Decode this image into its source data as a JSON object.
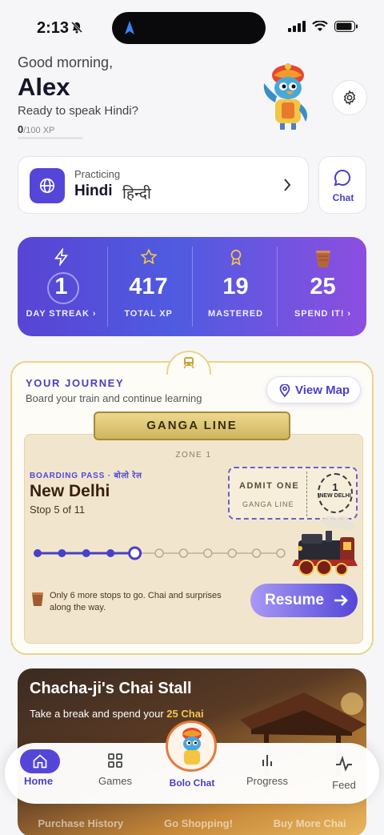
{
  "status_bar": {
    "time": "2:13"
  },
  "header": {
    "greeting": "Good morning,",
    "name": "Alex",
    "prompt": "Ready to speak Hindi?",
    "xp_current": "0",
    "xp_total": "/100 XP",
    "xp_progress": 0
  },
  "language_card": {
    "label": "Practicing",
    "language": "Hindi",
    "native": "हिन्दी"
  },
  "chat_card": {
    "label": "Chat"
  },
  "stats": [
    {
      "value": "1",
      "label": "DAY STREAK ›",
      "icon": "lightning-icon"
    },
    {
      "value": "417",
      "label": "TOTAL XP",
      "icon": "star-icon"
    },
    {
      "value": "19",
      "label": "MASTERED",
      "icon": "medal-icon"
    },
    {
      "value": "25",
      "label": "SPEND IT! ›",
      "icon": "chai-cup-icon"
    }
  ],
  "journey": {
    "title": "YOUR JOURNEY",
    "subtitle": "Board your train and continue learning",
    "view_map": "View Map",
    "line_name": "GANGA LINE",
    "zone": "ZONE 1",
    "boarding_pass": "BOARDING PASS · बोलो रेल",
    "station": "New Delhi",
    "stop": "Stop 5 of 11",
    "admit_one": "ADMIT ONE",
    "admit_line": "GANGA LINE",
    "stamp_num": "1",
    "stamp_place": "NEW DELHI",
    "stops_total": 11,
    "stops_done": 4,
    "current_stop": 5,
    "note": "Only 6 more stops to go. Chai and surprises along the way.",
    "resume": "Resume"
  },
  "chai_stall": {
    "title": "Chacha-ji's Chai Stall",
    "sub_prefix": "Take a break and spend your",
    "sub_amount": "25",
    "sub_suffix": "Chai",
    "footer": [
      "Purchase History",
      "Go Shopping!",
      "Buy More Chai"
    ]
  },
  "bottom_nav": {
    "items": [
      {
        "label": "Home",
        "icon": "home-icon"
      },
      {
        "label": "Games",
        "icon": "grid-icon"
      },
      {
        "label": "Bolo Chat",
        "icon": "mascot-avatar"
      },
      {
        "label": "Progress",
        "icon": "bar-chart-icon"
      },
      {
        "label": "Feed",
        "icon": "pulse-icon"
      }
    ]
  },
  "colors": {
    "accent": "#5446d8",
    "gold": "#e9d48a",
    "chai": "#f3c64a"
  }
}
